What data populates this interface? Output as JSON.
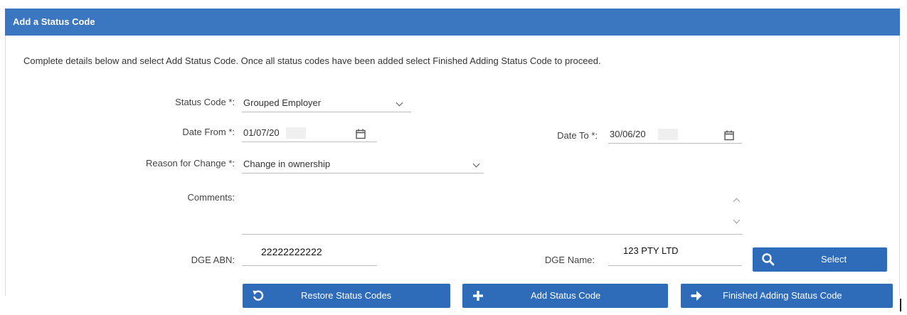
{
  "panel": {
    "title": "Add a Status Code"
  },
  "instructions": "Complete details below and select Add Status Code. Once all status codes have been added select Finished Adding Status Code to proceed.",
  "form": {
    "status_code": {
      "label": "Status Code *:",
      "value": "Grouped Employer"
    },
    "date_from": {
      "label": "Date From *:",
      "value": "01/07/20"
    },
    "date_to": {
      "label": "Date To *:",
      "value": "30/06/20"
    },
    "reason": {
      "label": "Reason for Change *:",
      "value": "Change in ownership"
    },
    "comments": {
      "label": "Comments:",
      "value": ""
    },
    "dge_abn": {
      "label": "DGE ABN:",
      "value": "22222222222"
    },
    "dge_name": {
      "label": "DGE Name:",
      "value": "123 PTY LTD"
    }
  },
  "buttons": {
    "select": "Select",
    "restore": "Restore Status Codes",
    "add": "Add Status Code",
    "finished": "Finished Adding Status Code"
  },
  "icons": {
    "calendar": "calendar-icon",
    "dropdown": "chevron-down-icon",
    "search": "search-icon",
    "restore": "undo-icon",
    "add": "plus-icon",
    "finished": "arrow-right-icon"
  },
  "colors": {
    "header": "#3a77c0",
    "button": "#2e6bb8",
    "header_text": "#ffffff"
  }
}
